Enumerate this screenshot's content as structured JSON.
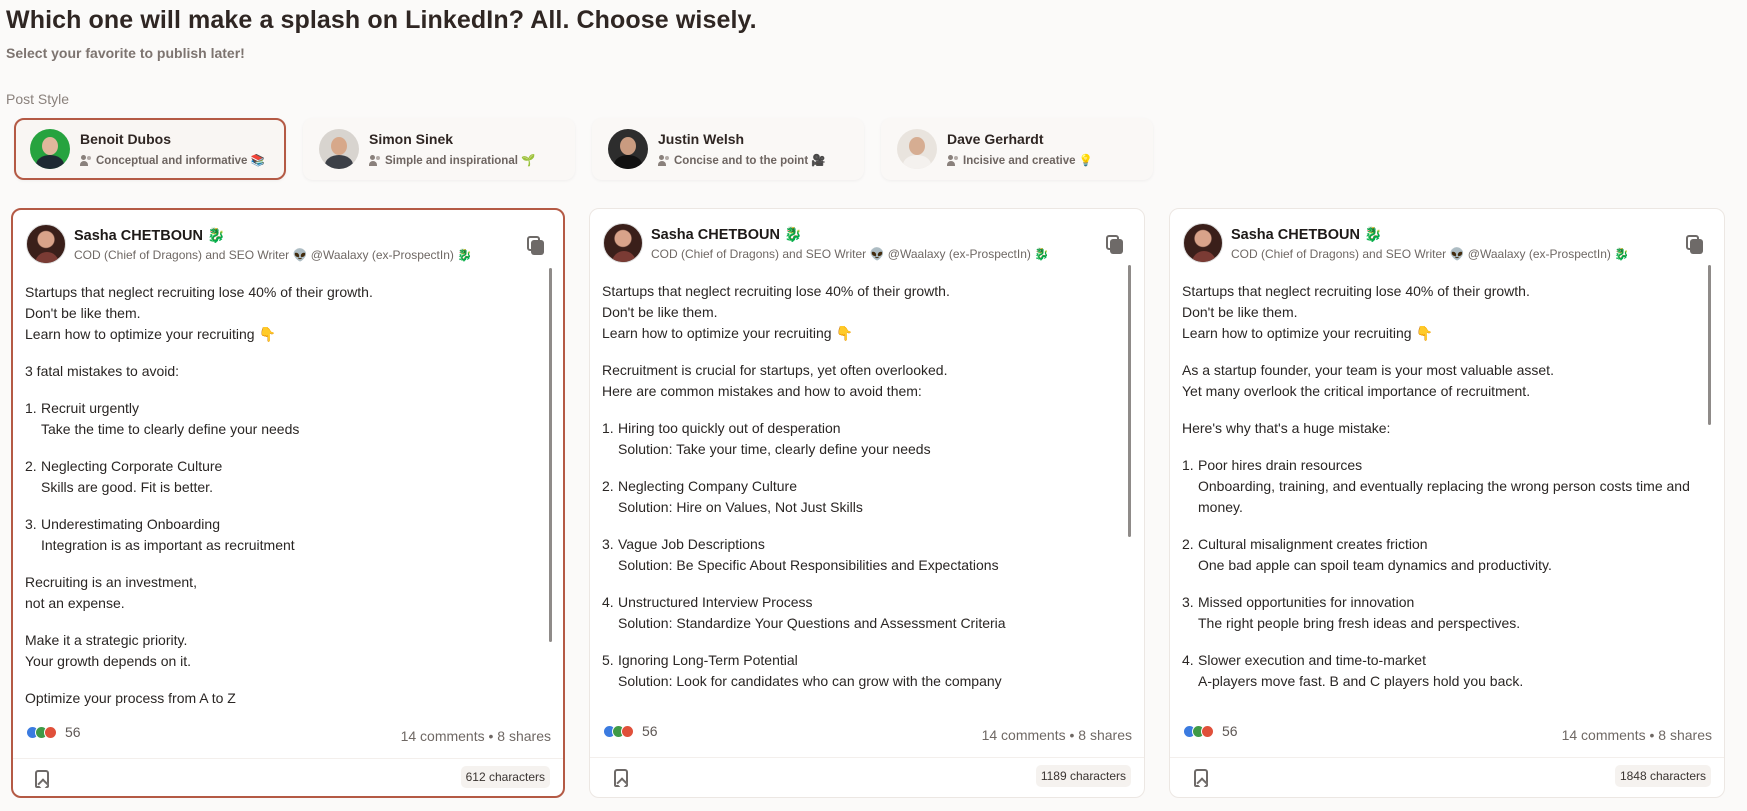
{
  "header": {
    "title": "Which one will make a splash on LinkedIn? All. Choose wisely.",
    "subtitle": "Select your favorite to publish later!",
    "section_label": "Post Style"
  },
  "styles": [
    {
      "name": "Benoit Dubos",
      "desc": "Conceptual and informative 📚",
      "selected": true
    },
    {
      "name": "Simon Sinek",
      "desc": "Simple and inspirational 🌱",
      "selected": false
    },
    {
      "name": "Justin Welsh",
      "desc": "Concise and to the point 🎥",
      "selected": false
    },
    {
      "name": "Dave Gerhardt",
      "desc": "Incisive and creative 💡",
      "selected": false
    }
  ],
  "author": {
    "name": "Sasha CHETBOUN 🐉",
    "tagline": "COD (Chief of Dragons) and SEO Writer 👽 @Waalaxy (ex-ProspectIn) 🐉"
  },
  "posts": [
    {
      "intro": [
        "Startups that neglect recruiting lose 40% of their growth.",
        "Don't be like them.",
        "Learn how to optimize your recruiting 👇"
      ],
      "lead": [
        "3 fatal mistakes to avoid:"
      ],
      "items": [
        {
          "num": "1.",
          "title": "Recruit urgently",
          "detail": "Take the time to clearly define your needs"
        },
        {
          "num": "2.",
          "title": "Neglecting Corporate Culture",
          "detail": "Skills are good. Fit is better."
        },
        {
          "num": "3.",
          "title": "Underestimating Onboarding",
          "detail": "Integration is as important as recruitment"
        }
      ],
      "closing": [
        [
          "Recruiting is an investment,",
          "not an expense."
        ],
        [
          "Make it a strategic priority.",
          "Your growth depends on it."
        ],
        [
          "Optimize your process from A to Z"
        ]
      ],
      "reactions_count": "56",
      "stats": "14 comments • 8 shares",
      "char_count": "612 characters",
      "selected": true
    },
    {
      "intro": [
        "Startups that neglect recruiting lose 40% of their growth.",
        "Don't be like them.",
        "Learn how to optimize your recruiting 👇"
      ],
      "lead": [
        "Recruitment is crucial for startups, yet often overlooked.",
        "Here are common mistakes and how to avoid them:"
      ],
      "items": [
        {
          "num": "1.",
          "title": "Hiring too quickly out of desperation",
          "detail": "Solution: Take your time, clearly define your needs"
        },
        {
          "num": "2.",
          "title": "Neglecting Company Culture",
          "detail": "Solution: Hire on Values, Not Just Skills"
        },
        {
          "num": "3.",
          "title": "Vague Job Descriptions",
          "detail": "Solution: Be Specific About Responsibilities and Expectations"
        },
        {
          "num": "4.",
          "title": "Unstructured Interview Process",
          "detail": "Solution: Standardize Your Questions and Assessment Criteria"
        },
        {
          "num": "5.",
          "title": "Ignoring Long-Term Potential",
          "detail": "Solution: Look for candidates who can grow with the company"
        }
      ],
      "closing": [],
      "reactions_count": "56",
      "stats": "14 comments • 8 shares",
      "char_count": "1189 characters",
      "selected": false
    },
    {
      "intro": [
        "Startups that neglect recruiting lose 40% of their growth.",
        "Don't be like them.",
        "Learn how to optimize your recruiting 👇"
      ],
      "lead": [
        "As a startup founder, your team is your most valuable asset.",
        "Yet many overlook the critical importance of recruitment."
      ],
      "lead2": [
        "Here's why that's a huge mistake:"
      ],
      "items": [
        {
          "num": "1.",
          "title": "Poor hires drain resources",
          "detail": "Onboarding, training, and eventually replacing the wrong person costs time and money."
        },
        {
          "num": "2.",
          "title": "Cultural misalignment creates friction",
          "detail": "One bad apple can spoil team dynamics and productivity."
        },
        {
          "num": "3.",
          "title": "Missed opportunities for innovation",
          "detail": "The right people bring fresh ideas and perspectives."
        },
        {
          "num": "4.",
          "title": "Slower execution and time-to-market",
          "detail": "A-players move fast. B and C players hold you back."
        }
      ],
      "closing": [],
      "reactions_count": "56",
      "stats": "14 comments • 8 shares",
      "char_count": "1848 characters",
      "selected": false
    }
  ],
  "colors": {
    "accent": "#b45a45",
    "background": "#fbfaf9"
  }
}
